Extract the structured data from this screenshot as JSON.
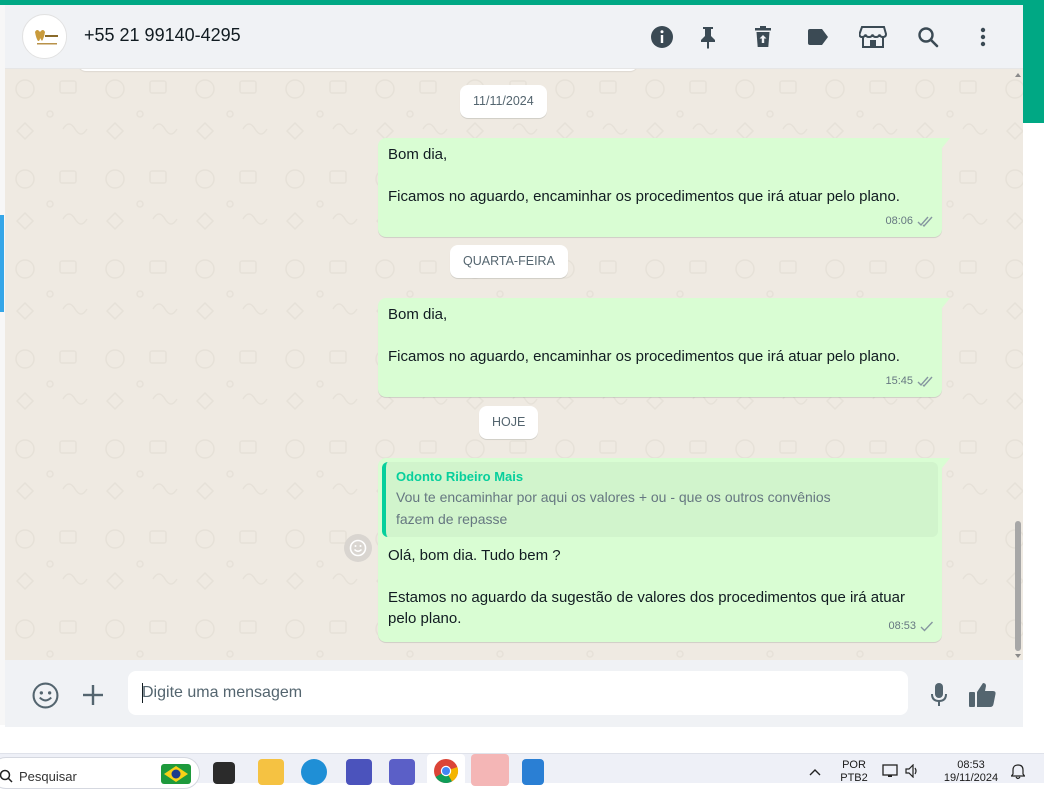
{
  "header": {
    "contact_name": "+55 21 99140-4295",
    "avatar_text": "Odonto",
    "icons": [
      "info-icon",
      "pin-icon",
      "delete-icon",
      "label-icon",
      "store-icon",
      "search-icon",
      "more-options-icon"
    ]
  },
  "messages": [
    {
      "date": "11/11/2024",
      "lines": [
        "Bom dia,",
        "",
        "Ficamos no aguardo, encaminhar os procedimentos que irá atuar pelo plano."
      ],
      "time": "08:06",
      "status": "double-check"
    },
    {
      "date": "QUARTA-FEIRA",
      "lines": [
        "Bom dia,",
        "",
        "Ficamos no aguardo, encaminhar os procedimentos que irá atuar pelo plano."
      ],
      "time": "15:45",
      "status": "double-check"
    },
    {
      "date": "HOJE",
      "quote": {
        "author": "Odonto Ribeiro Mais",
        "text": "Vou te encaminhar por aqui os valores + ou - que os outros convênios fazem de repasse"
      },
      "lines": [
        "Olá, bom dia. Tudo bem ?",
        "",
        "Estamos no aguardo da sugestão de valores dos procedimentos que irá atuar pelo plano."
      ],
      "time": "08:53",
      "status": "single-check"
    }
  ],
  "composer": {
    "placeholder": "Digite uma mensagem",
    "icons": [
      "emoji-icon",
      "attach-plus-icon",
      "microphone-icon",
      "thumbs-up-icon"
    ]
  },
  "taskbar": {
    "search_placeholder": "Pesquisar",
    "lang_line1": "POR",
    "lang_line2": "PTB2",
    "clock_time": "08:53",
    "clock_date": "19/11/2024"
  },
  "colors": {
    "accent": "#00a884",
    "outgoing_bubble": "#d9fdd3",
    "chat_background": "#efeae2",
    "quote_author": "#06cf9c"
  }
}
